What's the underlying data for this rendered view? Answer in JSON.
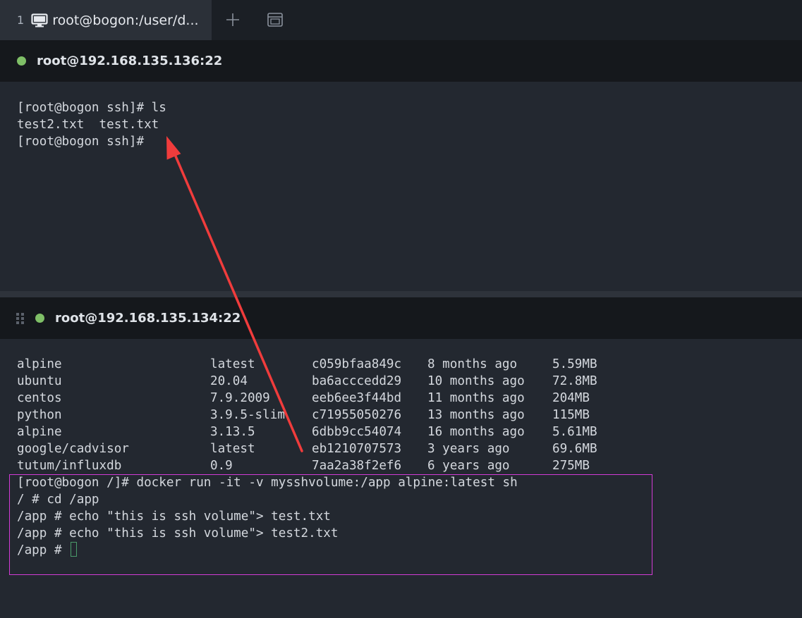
{
  "tab": {
    "number": "1",
    "title": "root@bogon:/user/d...",
    "icon": "monitor-icon"
  },
  "tab_actions": {
    "add_icon": "plus-icon",
    "layout_icon": "window-icon"
  },
  "pane1": {
    "host": "root@192.168.135.136:22",
    "status_color": "#7fbf67",
    "lines": [
      "[root@bogon ssh]# ls",
      "test2.txt  test.txt",
      "[root@bogon ssh]#"
    ]
  },
  "pane2": {
    "host": "root@192.168.135.134:22",
    "status_color": "#7fbf67",
    "images": [
      [
        "alpine",
        "latest",
        "c059bfaa849c",
        "8 months ago",
        "5.59MB"
      ],
      [
        "ubuntu",
        "20.04",
        "ba6acccedd29",
        "10 months ago",
        "72.8MB"
      ],
      [
        "centos",
        "7.9.2009",
        "eeb6ee3f44bd",
        "11 months ago",
        "204MB"
      ],
      [
        "python",
        "3.9.5-slim",
        "c71955050276",
        "13 months ago",
        "115MB"
      ],
      [
        "alpine",
        "3.13.5",
        "6dbb9cc54074",
        "16 months ago",
        "5.61MB"
      ],
      [
        "google/cadvisor",
        "latest",
        "eb1210707573",
        "3 years ago",
        "69.6MB"
      ],
      [
        "tutum/influxdb",
        "0.9",
        "7aa2a38f2ef6",
        "6 years ago",
        "275MB"
      ]
    ],
    "commands": [
      "[root@bogon /]# docker run -it -v mysshvolume:/app alpine:latest sh",
      "/ # cd /app",
      "/app # echo \"this is ssh volume\"> test.txt",
      "/app # echo \"this is ssh volume\"> test2.txt",
      "/app # "
    ]
  },
  "annotation": {
    "arrow_color": "#f03c3c",
    "box_color": "#d23bd6"
  }
}
